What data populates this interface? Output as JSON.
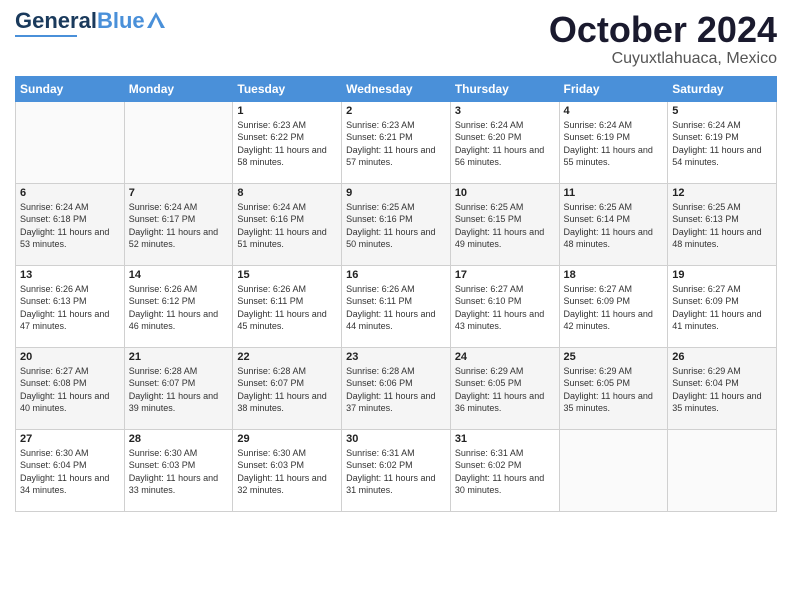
{
  "header": {
    "logo": {
      "text1": "General",
      "text2": "Blue"
    },
    "month": "October 2024",
    "location": "Cuyuxtlahuaca, Mexico"
  },
  "days_of_week": [
    "Sunday",
    "Monday",
    "Tuesday",
    "Wednesday",
    "Thursday",
    "Friday",
    "Saturday"
  ],
  "weeks": [
    [
      {
        "day": "",
        "content": ""
      },
      {
        "day": "",
        "content": ""
      },
      {
        "day": "1",
        "sunrise": "Sunrise: 6:23 AM",
        "sunset": "Sunset: 6:22 PM",
        "daylight": "Daylight: 11 hours and 58 minutes."
      },
      {
        "day": "2",
        "sunrise": "Sunrise: 6:23 AM",
        "sunset": "Sunset: 6:21 PM",
        "daylight": "Daylight: 11 hours and 57 minutes."
      },
      {
        "day": "3",
        "sunrise": "Sunrise: 6:24 AM",
        "sunset": "Sunset: 6:20 PM",
        "daylight": "Daylight: 11 hours and 56 minutes."
      },
      {
        "day": "4",
        "sunrise": "Sunrise: 6:24 AM",
        "sunset": "Sunset: 6:19 PM",
        "daylight": "Daylight: 11 hours and 55 minutes."
      },
      {
        "day": "5",
        "sunrise": "Sunrise: 6:24 AM",
        "sunset": "Sunset: 6:19 PM",
        "daylight": "Daylight: 11 hours and 54 minutes."
      }
    ],
    [
      {
        "day": "6",
        "sunrise": "Sunrise: 6:24 AM",
        "sunset": "Sunset: 6:18 PM",
        "daylight": "Daylight: 11 hours and 53 minutes."
      },
      {
        "day": "7",
        "sunrise": "Sunrise: 6:24 AM",
        "sunset": "Sunset: 6:17 PM",
        "daylight": "Daylight: 11 hours and 52 minutes."
      },
      {
        "day": "8",
        "sunrise": "Sunrise: 6:24 AM",
        "sunset": "Sunset: 6:16 PM",
        "daylight": "Daylight: 11 hours and 51 minutes."
      },
      {
        "day": "9",
        "sunrise": "Sunrise: 6:25 AM",
        "sunset": "Sunset: 6:16 PM",
        "daylight": "Daylight: 11 hours and 50 minutes."
      },
      {
        "day": "10",
        "sunrise": "Sunrise: 6:25 AM",
        "sunset": "Sunset: 6:15 PM",
        "daylight": "Daylight: 11 hours and 49 minutes."
      },
      {
        "day": "11",
        "sunrise": "Sunrise: 6:25 AM",
        "sunset": "Sunset: 6:14 PM",
        "daylight": "Daylight: 11 hours and 48 minutes."
      },
      {
        "day": "12",
        "sunrise": "Sunrise: 6:25 AM",
        "sunset": "Sunset: 6:13 PM",
        "daylight": "Daylight: 11 hours and 48 minutes."
      }
    ],
    [
      {
        "day": "13",
        "sunrise": "Sunrise: 6:26 AM",
        "sunset": "Sunset: 6:13 PM",
        "daylight": "Daylight: 11 hours and 47 minutes."
      },
      {
        "day": "14",
        "sunrise": "Sunrise: 6:26 AM",
        "sunset": "Sunset: 6:12 PM",
        "daylight": "Daylight: 11 hours and 46 minutes."
      },
      {
        "day": "15",
        "sunrise": "Sunrise: 6:26 AM",
        "sunset": "Sunset: 6:11 PM",
        "daylight": "Daylight: 11 hours and 45 minutes."
      },
      {
        "day": "16",
        "sunrise": "Sunrise: 6:26 AM",
        "sunset": "Sunset: 6:11 PM",
        "daylight": "Daylight: 11 hours and 44 minutes."
      },
      {
        "day": "17",
        "sunrise": "Sunrise: 6:27 AM",
        "sunset": "Sunset: 6:10 PM",
        "daylight": "Daylight: 11 hours and 43 minutes."
      },
      {
        "day": "18",
        "sunrise": "Sunrise: 6:27 AM",
        "sunset": "Sunset: 6:09 PM",
        "daylight": "Daylight: 11 hours and 42 minutes."
      },
      {
        "day": "19",
        "sunrise": "Sunrise: 6:27 AM",
        "sunset": "Sunset: 6:09 PM",
        "daylight": "Daylight: 11 hours and 41 minutes."
      }
    ],
    [
      {
        "day": "20",
        "sunrise": "Sunrise: 6:27 AM",
        "sunset": "Sunset: 6:08 PM",
        "daylight": "Daylight: 11 hours and 40 minutes."
      },
      {
        "day": "21",
        "sunrise": "Sunrise: 6:28 AM",
        "sunset": "Sunset: 6:07 PM",
        "daylight": "Daylight: 11 hours and 39 minutes."
      },
      {
        "day": "22",
        "sunrise": "Sunrise: 6:28 AM",
        "sunset": "Sunset: 6:07 PM",
        "daylight": "Daylight: 11 hours and 38 minutes."
      },
      {
        "day": "23",
        "sunrise": "Sunrise: 6:28 AM",
        "sunset": "Sunset: 6:06 PM",
        "daylight": "Daylight: 11 hours and 37 minutes."
      },
      {
        "day": "24",
        "sunrise": "Sunrise: 6:29 AM",
        "sunset": "Sunset: 6:05 PM",
        "daylight": "Daylight: 11 hours and 36 minutes."
      },
      {
        "day": "25",
        "sunrise": "Sunrise: 6:29 AM",
        "sunset": "Sunset: 6:05 PM",
        "daylight": "Daylight: 11 hours and 35 minutes."
      },
      {
        "day": "26",
        "sunrise": "Sunrise: 6:29 AM",
        "sunset": "Sunset: 6:04 PM",
        "daylight": "Daylight: 11 hours and 35 minutes."
      }
    ],
    [
      {
        "day": "27",
        "sunrise": "Sunrise: 6:30 AM",
        "sunset": "Sunset: 6:04 PM",
        "daylight": "Daylight: 11 hours and 34 minutes."
      },
      {
        "day": "28",
        "sunrise": "Sunrise: 6:30 AM",
        "sunset": "Sunset: 6:03 PM",
        "daylight": "Daylight: 11 hours and 33 minutes."
      },
      {
        "day": "29",
        "sunrise": "Sunrise: 6:30 AM",
        "sunset": "Sunset: 6:03 PM",
        "daylight": "Daylight: 11 hours and 32 minutes."
      },
      {
        "day": "30",
        "sunrise": "Sunrise: 6:31 AM",
        "sunset": "Sunset: 6:02 PM",
        "daylight": "Daylight: 11 hours and 31 minutes."
      },
      {
        "day": "31",
        "sunrise": "Sunrise: 6:31 AM",
        "sunset": "Sunset: 6:02 PM",
        "daylight": "Daylight: 11 hours and 30 minutes."
      },
      {
        "day": "",
        "content": ""
      },
      {
        "day": "",
        "content": ""
      }
    ]
  ]
}
